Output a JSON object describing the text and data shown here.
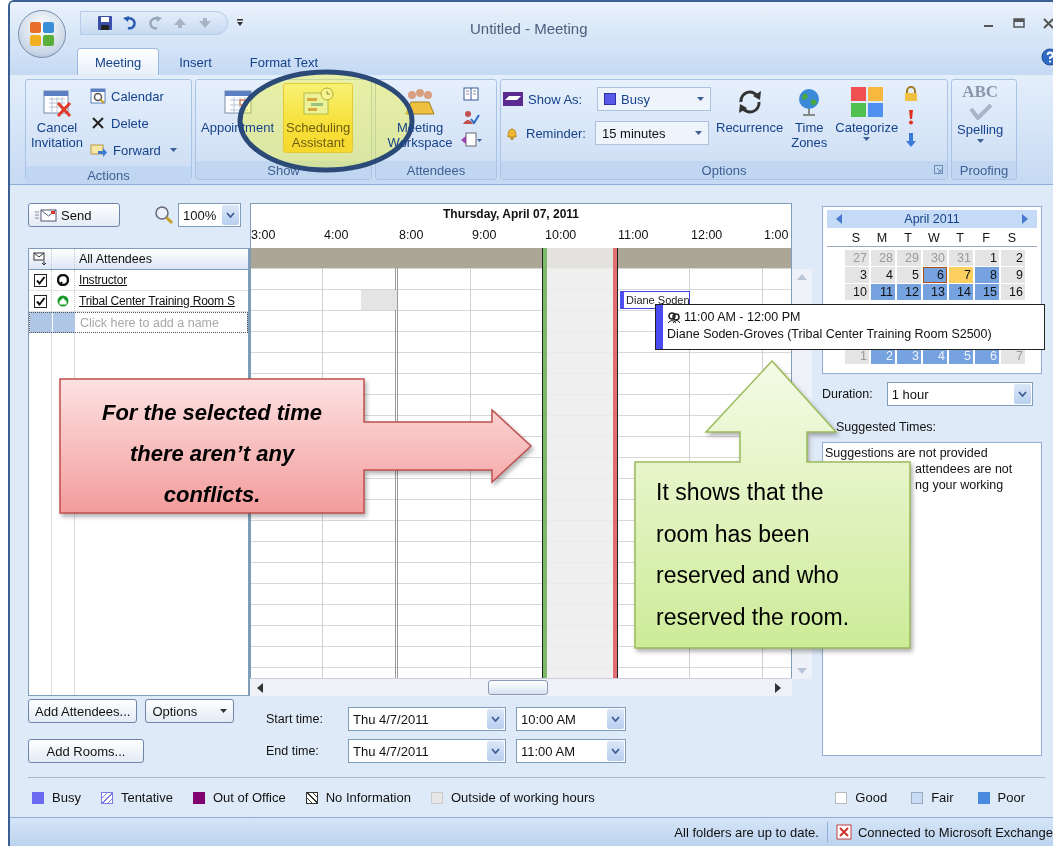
{
  "window": {
    "title": "Untitled - Meeting"
  },
  "ribbon_tabs": [
    {
      "label": "Meeting",
      "selected": true
    },
    {
      "label": "Insert",
      "selected": false
    },
    {
      "label": "Format Text",
      "selected": false
    }
  ],
  "ribbon": {
    "actions": {
      "label": "Actions",
      "cancel": "Cancel Invitation",
      "calendar": "Calendar",
      "delete": "Delete",
      "forward": "Forward"
    },
    "show": {
      "label": "Show",
      "buttons": [
        {
          "label": "Appointment",
          "selected": false
        },
        {
          "label": "Scheduling Assistant",
          "selected": true
        }
      ]
    },
    "attendees": {
      "label": "Attendees",
      "workspace": "Meeting Workspace"
    },
    "options": {
      "label": "Options",
      "show_as_label": "Show As:",
      "show_as": "Busy",
      "reminder_label": "Reminder:",
      "reminder": "15 minutes",
      "recurrence": "Recurrence",
      "time_zones": "Time Zones",
      "categorize": "Categorize"
    },
    "proofing": {
      "label": "Proofing",
      "icon_text": "ABC",
      "spelling": "Spelling"
    }
  },
  "toolbar": {
    "send": "Send",
    "zoom": "100%"
  },
  "attendee_list": {
    "header": "All Attendees",
    "add_placeholder": "Click here to add a name",
    "rows": [
      {
        "name": "Instructor",
        "checked": true,
        "kind": "person"
      },
      {
        "name": "Tribal Center Training Room S",
        "checked": true,
        "kind": "room"
      }
    ]
  },
  "grid": {
    "date": "Thursday, April 07, 2011",
    "hours": [
      "3:00",
      "4:00",
      "8:00",
      "9:00",
      "10:00",
      "11:00",
      "12:00",
      "1:00"
    ],
    "event": "Diane Soden",
    "tooltip": {
      "time": "11:00 AM - 12:00 PM",
      "detail": "Diane Soden-Groves  (Tribal Center Training Room S2500)"
    }
  },
  "buttons": {
    "add_attendees": "Add Attendees...",
    "options": "Options",
    "add_rooms": "Add Rooms..."
  },
  "time_fields": {
    "start_label": "Start time:",
    "start_date": "Thu 4/7/2011",
    "start_time": "10:00 AM",
    "end_label": "End time:",
    "end_date": "Thu 4/7/2011",
    "end_time": "11:00 AM"
  },
  "calendar": {
    "month": "April 2011",
    "weekdays": [
      "S",
      "M",
      "T",
      "W",
      "T",
      "F",
      "S"
    ],
    "weeks": [
      [
        {
          "day": "27",
          "kind": "other"
        },
        {
          "day": "28",
          "kind": "other"
        },
        {
          "day": "29",
          "kind": "other"
        },
        {
          "day": "30",
          "kind": "other"
        },
        {
          "day": "31",
          "kind": "other"
        },
        {
          "day": "1",
          "kind": "plain"
        },
        {
          "day": "2",
          "kind": "plain"
        }
      ],
      [
        {
          "day": "3",
          "kind": "plain"
        },
        {
          "day": "4",
          "kind": "plain"
        },
        {
          "day": "5",
          "kind": "plain"
        },
        {
          "day": "6",
          "kind": "selected"
        },
        {
          "day": "7",
          "kind": "today"
        },
        {
          "day": "8",
          "kind": "busy"
        },
        {
          "day": "9",
          "kind": "plain"
        }
      ],
      [
        {
          "day": "10",
          "kind": "plain"
        },
        {
          "day": "11",
          "kind": "busy"
        },
        {
          "day": "12",
          "kind": "busy"
        },
        {
          "day": "13",
          "kind": "busy"
        },
        {
          "day": "14",
          "kind": "busy"
        },
        {
          "day": "15",
          "kind": "busy"
        },
        {
          "day": "16",
          "kind": "plain"
        }
      ],
      [
        {
          "day": "1",
          "kind": "other"
        },
        {
          "day": "2",
          "kind": "faded"
        },
        {
          "day": "3",
          "kind": "faded"
        },
        {
          "day": "4",
          "kind": "faded"
        },
        {
          "day": "5",
          "kind": "faded"
        },
        {
          "day": "6",
          "kind": "faded"
        },
        {
          "day": "7",
          "kind": "other"
        }
      ]
    ]
  },
  "duration": {
    "label": "Duration:",
    "value": "1 hour"
  },
  "suggested": {
    "label": "Suggested Times:",
    "lines": [
      "Suggestions are not provided",
      "attendees are not",
      "ng your working"
    ]
  },
  "legend": [
    {
      "label": "Busy",
      "kind": "busy"
    },
    {
      "label": "Tentative",
      "kind": "tentative"
    },
    {
      "label": "Out of Office",
      "kind": "oof"
    },
    {
      "label": "No Information",
      "kind": "noinfo"
    },
    {
      "label": "Outside of working hours",
      "kind": "outside"
    }
  ],
  "quality_legend": [
    {
      "label": "Good",
      "kind": "good"
    },
    {
      "label": "Fair",
      "kind": "fair"
    },
    {
      "label": "Poor",
      "kind": "poor"
    }
  ],
  "status_bar": {
    "sync": "All folders are up to date.",
    "connection": "Connected to Microsoft Exchange"
  },
  "callouts": [
    {
      "kind": "arrow-right",
      "text": "For the selected time there aren’t any conflicts."
    },
    {
      "kind": "arrow-up",
      "text": "It shows that the room has been reserved and who reserved the room."
    }
  ]
}
